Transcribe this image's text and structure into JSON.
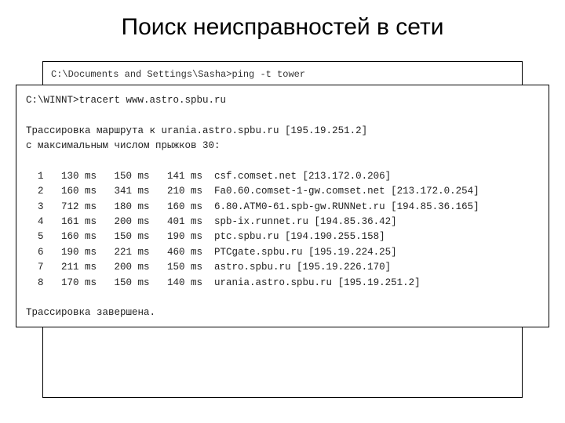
{
  "title": "Поиск неисправностей в сети",
  "outer": {
    "line1": "C:\\Documents and Settings\\Sasha>ping -t tower"
  },
  "inner": {
    "prompt": "C:\\WINNT>tracert www.astro.spbu.ru",
    "intro1": "Трассировка маршрута к urania.astro.spbu.ru [195.19.251.2]",
    "intro2": "с максимальным числом прыжков 30:",
    "hops": [
      "  1   130 ms   150 ms   141 ms  csf.comset.net [213.172.0.206]",
      "  2   160 ms   341 ms   210 ms  Fa0.60.comset-1-gw.comset.net [213.172.0.254]",
      "  3   712 ms   180 ms   160 ms  6.80.ATM0-61.spb-gw.RUNNet.ru [194.85.36.165]",
      "  4   161 ms   200 ms   401 ms  spb-ix.runnet.ru [194.85.36.42]",
      "  5   160 ms   150 ms   190 ms  ptc.spbu.ru [194.190.255.158]",
      "  6   190 ms   221 ms   460 ms  PTCgate.spbu.ru [195.19.224.25]",
      "  7   211 ms   200 ms   150 ms  astro.spbu.ru [195.19.226.170]",
      "  8   170 ms   150 ms   140 ms  urania.astro.spbu.ru [195.19.251.2]"
    ],
    "done": "Трассировка завершена."
  }
}
